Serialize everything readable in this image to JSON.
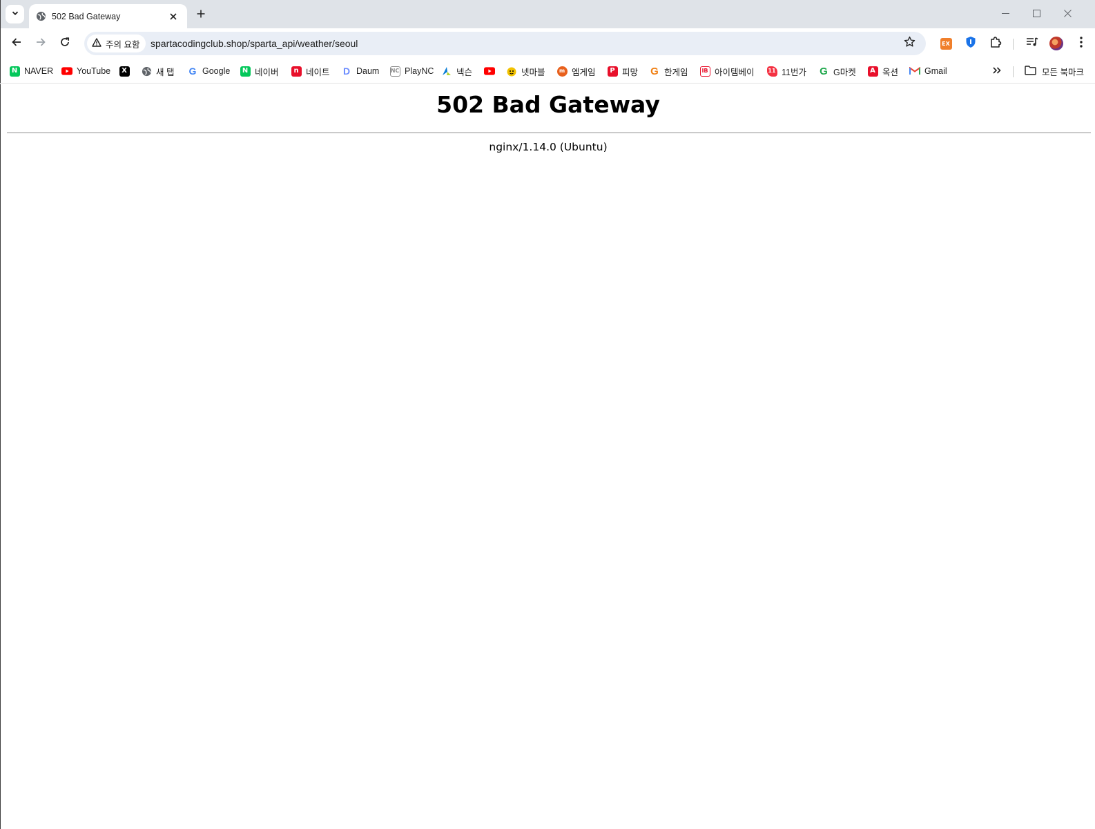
{
  "tab": {
    "title": "502 Bad Gateway"
  },
  "omnibox": {
    "security_chip": "주의 요함",
    "url": "spartacodingclub.shop/sparta_api/weather/seoul"
  },
  "bookmarks": [
    {
      "label": "NAVER",
      "icon": "naver-icon",
      "color": "#03c75a"
    },
    {
      "label": "YouTube",
      "icon": "youtube-icon",
      "color": "#ff0000"
    },
    {
      "label": "",
      "icon": "x-icon",
      "color": "#000000"
    },
    {
      "label": "새 탭",
      "icon": "globe-icon",
      "color": "#5f6368"
    },
    {
      "label": "Google",
      "icon": "google-icon",
      "color": "#4285f4"
    },
    {
      "label": "네이버",
      "icon": "naver-icon",
      "color": "#03c75a"
    },
    {
      "label": "네이트",
      "icon": "nate-icon",
      "color": "#e8102b"
    },
    {
      "label": "Daum",
      "icon": "daum-icon",
      "color": "#6b8cff"
    },
    {
      "label": "PlayNC",
      "icon": "plaync-icon",
      "color": "#8a8a8a"
    },
    {
      "label": "넥슨",
      "icon": "nexon-icon",
      "color": "#0a7dd6"
    },
    {
      "label": "",
      "icon": "youtube-icon",
      "color": "#ff0000"
    },
    {
      "label": "넷마블",
      "icon": "netmarble-icon",
      "color": "#f2c200"
    },
    {
      "label": "엠게임",
      "icon": "mgame-icon",
      "color": "#e8601c"
    },
    {
      "label": "피망",
      "icon": "pmang-icon",
      "color": "#e8102b"
    },
    {
      "label": "한게임",
      "icon": "hangame-icon",
      "color": "#f07f13"
    },
    {
      "label": "아이템베이",
      "icon": "itembay-icon",
      "color": "#e8102b"
    },
    {
      "label": "11번가",
      "icon": "11st-icon",
      "color": "#f43142"
    },
    {
      "label": "G마켓",
      "icon": "gmarket-icon",
      "color": "#1fa84c"
    },
    {
      "label": "옥션",
      "icon": "auction-icon",
      "color": "#e8102b"
    },
    {
      "label": "Gmail",
      "icon": "gmail-icon",
      "color": "#ea4335"
    }
  ],
  "bookmarks_all_label": "모든 북마크",
  "page": {
    "heading": "502 Bad Gateway",
    "server": "nginx/1.14.0 (Ubuntu)"
  }
}
